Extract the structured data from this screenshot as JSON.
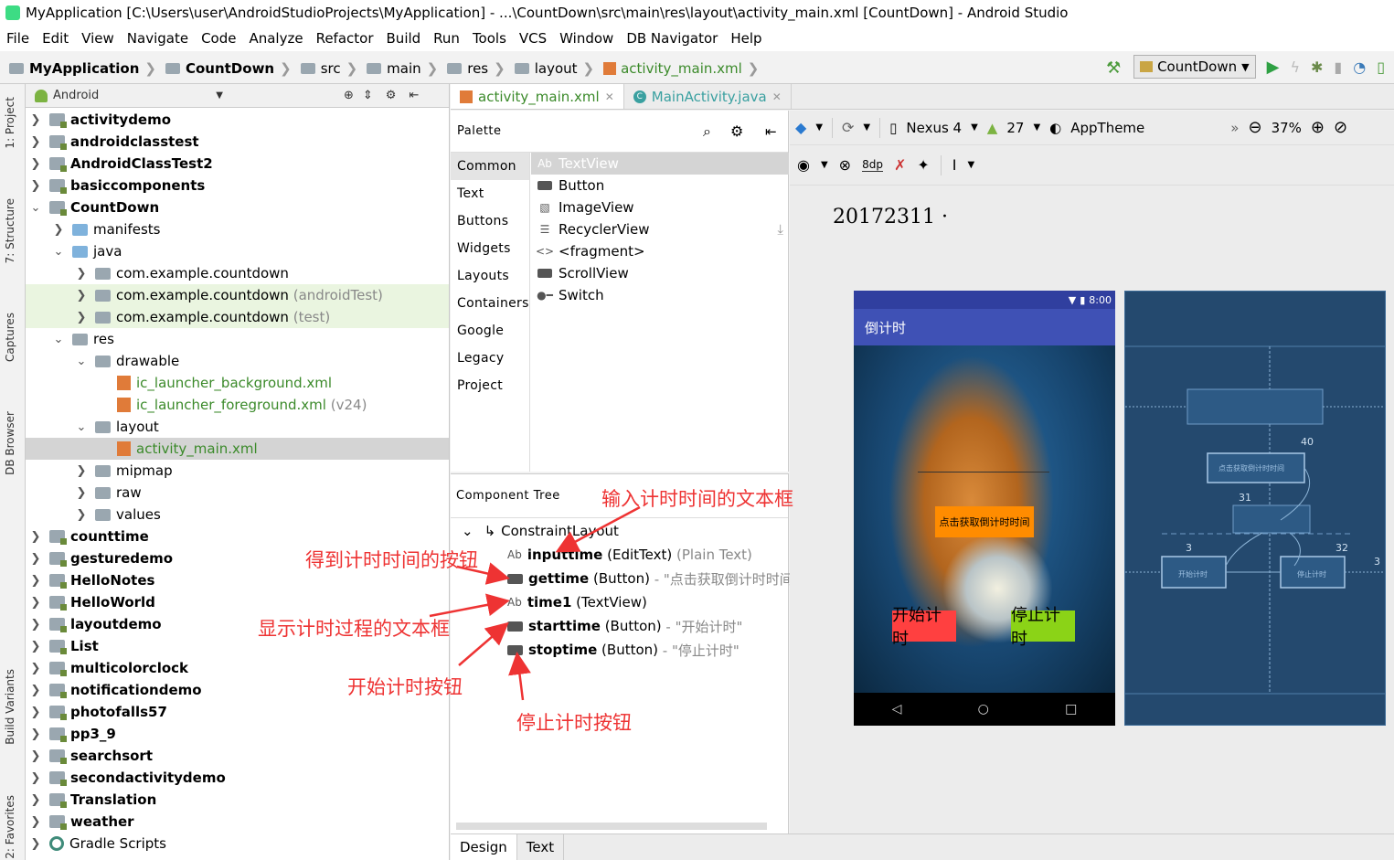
{
  "window": {
    "title": "MyApplication [C:\\Users\\user\\AndroidStudioProjects\\MyApplication] - ...\\CountDown\\src\\main\\res\\layout\\activity_main.xml [CountDown] - Android Studio"
  },
  "menu": [
    "File",
    "Edit",
    "View",
    "Navigate",
    "Code",
    "Analyze",
    "Refactor",
    "Build",
    "Run",
    "Tools",
    "VCS",
    "Window",
    "DB Navigator",
    "Help"
  ],
  "breadcrumb": [
    "MyApplication",
    "CountDown",
    "src",
    "main",
    "res",
    "layout",
    "activity_main.xml"
  ],
  "run_config": "CountDown",
  "side_tabs": [
    "1: Project",
    "7: Structure",
    "Captures",
    "DB Browser",
    "Build Variants",
    "2: Favorites"
  ],
  "project_panel": {
    "view_mode": "Android",
    "tree": [
      {
        "label": "activitydemo",
        "extra": ""
      },
      {
        "label": "androidclasstest",
        "extra": ""
      },
      {
        "label": "AndroidClassTest2",
        "extra": ""
      },
      {
        "label": "basiccomponents",
        "extra": ""
      },
      {
        "label": "CountDown",
        "extra": ""
      },
      {
        "label": "manifests",
        "extra": ""
      },
      {
        "label": "java",
        "extra": ""
      },
      {
        "label": "com.example.countdown",
        "extra": ""
      },
      {
        "label": "com.example.countdown",
        "extra": "(androidTest)"
      },
      {
        "label": "com.example.countdown",
        "extra": "(test)"
      },
      {
        "label": "res",
        "extra": ""
      },
      {
        "label": "drawable",
        "extra": ""
      },
      {
        "label": "ic_launcher_background.xml",
        "extra": ""
      },
      {
        "label": "ic_launcher_foreground.xml",
        "extra": "(v24)"
      },
      {
        "label": "layout",
        "extra": ""
      },
      {
        "label": "activity_main.xml",
        "extra": ""
      },
      {
        "label": "mipmap",
        "extra": ""
      },
      {
        "label": "raw",
        "extra": ""
      },
      {
        "label": "values",
        "extra": ""
      },
      {
        "label": "counttime",
        "extra": ""
      },
      {
        "label": "gesturedemo",
        "extra": ""
      },
      {
        "label": "HelloNotes",
        "extra": ""
      },
      {
        "label": "HelloWorld",
        "extra": ""
      },
      {
        "label": "layoutdemo",
        "extra": ""
      },
      {
        "label": "List",
        "extra": ""
      },
      {
        "label": "multicolorclock",
        "extra": ""
      },
      {
        "label": "notificationdemo",
        "extra": ""
      },
      {
        "label": "photofalls57",
        "extra": ""
      },
      {
        "label": "pp3_9",
        "extra": ""
      },
      {
        "label": "searchsort",
        "extra": ""
      },
      {
        "label": "secondactivitydemo",
        "extra": ""
      },
      {
        "label": "Translation",
        "extra": ""
      },
      {
        "label": "weather",
        "extra": ""
      },
      {
        "label": "Gradle Scripts",
        "extra": ""
      }
    ]
  },
  "editor_tabs": [
    "activity_main.xml",
    "MainActivity.java"
  ],
  "palette": {
    "title": "Palette",
    "categories": [
      "Common",
      "Text",
      "Buttons",
      "Widgets",
      "Layouts",
      "Containers",
      "Google",
      "Legacy",
      "Project"
    ],
    "items": [
      "TextView",
      "Button",
      "ImageView",
      "RecyclerView",
      "<fragment>",
      "ScrollView",
      "Switch"
    ]
  },
  "component_tree": {
    "title": "Component Tree",
    "root": "ConstraintLayout",
    "nodes": [
      {
        "id": "inputtime",
        "type": "(EditText)",
        "detail": "(Plain Text)"
      },
      {
        "id": "gettime",
        "type": "(Button)",
        "detail": "- \"点击获取倒计时时间\""
      },
      {
        "id": "time1",
        "type": "(TextView)",
        "detail": ""
      },
      {
        "id": "starttime",
        "type": "(Button)",
        "detail": "- \"开始计时\""
      },
      {
        "id": "stoptime",
        "type": "(Button)",
        "detail": "- \"停止计时\""
      }
    ]
  },
  "design_toolbar": {
    "device": "Nexus 4",
    "api": "27",
    "theme": "AppTheme",
    "zoom": "37%",
    "margin": "8dp",
    "more": "»"
  },
  "canvas": {
    "label": "20172311  ·"
  },
  "phone": {
    "time": "8:00",
    "app_title": "倒计时",
    "get_button": "点击获取倒计时时间",
    "start_button": "开始计时",
    "stop_button": "停止计时",
    "nav": [
      "◁",
      "○",
      "□"
    ]
  },
  "blueprint": {
    "get_button": "点击获取倒计时时间",
    "start_button": "开始计时",
    "stop_button": "停止计时",
    "margins": [
      "40",
      "31",
      "3",
      "32",
      "3"
    ]
  },
  "bottom_tabs": [
    "Design",
    "Text"
  ],
  "annotations": {
    "input_box": "输入计时时间的文本框",
    "get_button": "得到计时时间的按钮",
    "display_box": "显示计时过程的文本框",
    "start_button": "开始计时按钮",
    "stop_button": "停止计时按钮"
  },
  "colors": {
    "annotation": "#ee3333",
    "app_bar": "#3f51b5",
    "status_bar": "#303f9f",
    "blueprint": "#24496e",
    "get_btn": "#ff8c00",
    "start_btn": "#ff4040",
    "stop_btn": "#8bd317"
  }
}
